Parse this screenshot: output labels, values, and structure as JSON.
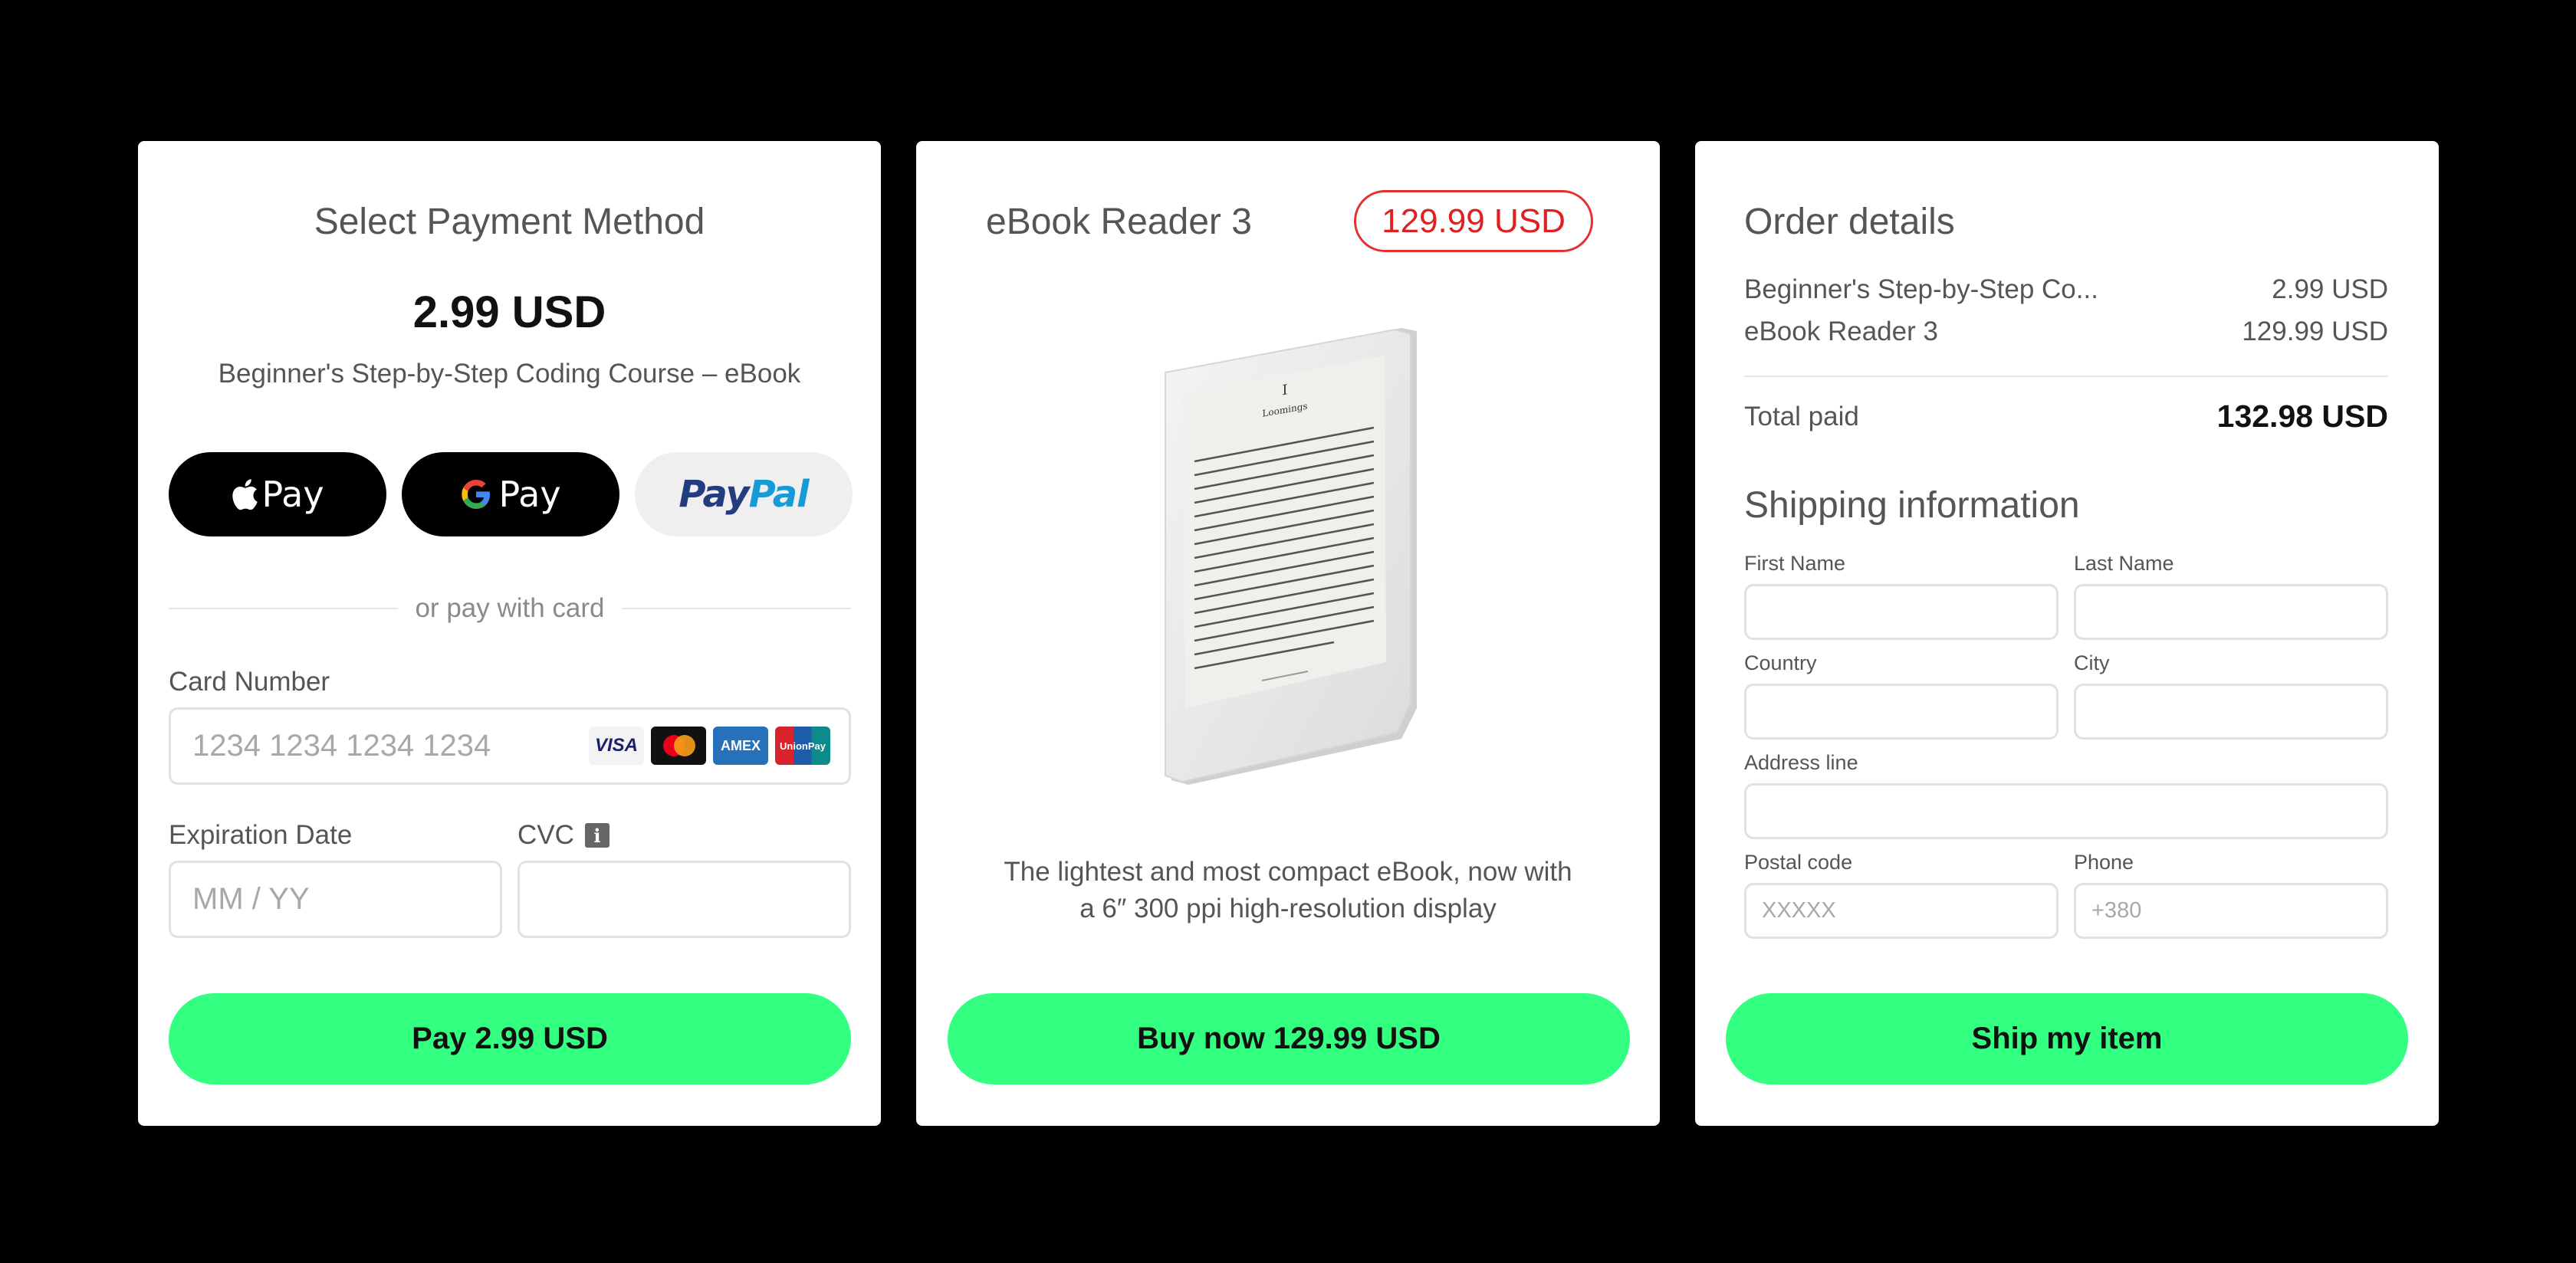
{
  "payment": {
    "title": "Select Payment Method",
    "price": "2.99 USD",
    "course": "Beginner's Step-by-Step Coding Course – eBook",
    "wallets": {
      "apple_pay": "Pay",
      "google_pay": "Pay",
      "paypal_pay": "Pay",
      "paypal_pal": "Pal"
    },
    "divider": "or pay with card",
    "card_number_label": "Card Number",
    "card_number_placeholder": "1234 1234 1234 1234",
    "card_brands": [
      "VISA",
      "AMEX",
      "UnionPay"
    ],
    "expiration_label": "Expiration Date",
    "expiration_placeholder": "MM / YY",
    "cvc_label": "CVC",
    "cta": "Pay 2.99 USD",
    "cta_color": "#33ff80"
  },
  "product": {
    "title": "eBook Reader 3",
    "price_badge": "129.99 USD",
    "price_badge_color": "#e02020",
    "screen_chapter_number": "I",
    "screen_chapter_title": "Loomings",
    "description_line1": "The lightest and most compact eBook, now with",
    "description_line2": "a 6″ 300 ppi high-resolution display",
    "cta": "Buy now 129.99 USD"
  },
  "order": {
    "title": "Order details",
    "items": [
      {
        "name": "Beginner's Step-by-Step Co...",
        "price": "2.99 USD"
      },
      {
        "name": "eBook Reader 3",
        "price": "129.99 USD"
      }
    ],
    "total_label": "Total paid",
    "total_value": "132.98 USD",
    "shipping_title": "Shipping information",
    "fields": {
      "first_name": {
        "label": "First Name",
        "placeholder": ""
      },
      "last_name": {
        "label": "Last Name",
        "placeholder": ""
      },
      "country": {
        "label": "Country",
        "placeholder": ""
      },
      "city": {
        "label": "City",
        "placeholder": ""
      },
      "address": {
        "label": "Address line",
        "placeholder": ""
      },
      "postal": {
        "label": "Postal code",
        "placeholder": "XXXXX"
      },
      "phone": {
        "label": "Phone",
        "placeholder": "+380"
      }
    },
    "cta": "Ship my item"
  }
}
